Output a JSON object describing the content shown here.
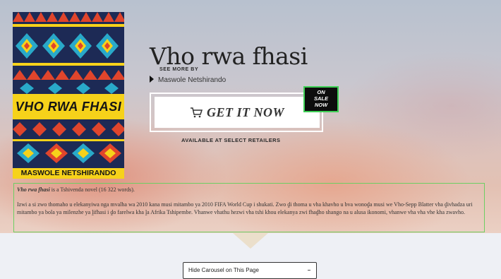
{
  "book": {
    "title": "Vho rwa fhasi",
    "see_more_label": "SEE MORE BY",
    "author": "Maswole Netshirando",
    "cover_title": "VHO RWA FHASI",
    "cover_author": "MASWOLE NETSHIRANDO"
  },
  "actions": {
    "get_it_label": "GET IT NOW",
    "sale_lines": [
      "ON",
      "SALE",
      "NOW"
    ],
    "available_text": "AVAILABLE AT SELECT RETAILERS"
  },
  "description": {
    "title": "Vho rwa fhasi",
    "summary": " is a Tshivenda novel (16 322 words).",
    "body": "Izwi a si zwo thomaho u elekanyiwa nga mvalha wa 2010 kana musi mitambo ya 2010 FIFA World Cup i shukati. Zwo ḓi thoma u vha khavho u bva wonoḓa musi we Vho-Sepp Blatter vha ḓivhadza uri mitambo ya bola ya milenzhe ya ḽifhasi i ḓo farelwa kha ḽa Afrika Tshipembe. Vhanwe vhathu hezwi vha tshi khou elekanya zwi fhaḓho shango na u alusa ikonomi, vhanwe vha vha vhe kha zwavho."
  },
  "footer": {
    "carousel_select": "Hide Carousel on This Page"
  },
  "colors": {
    "sale_border": "#3ecf55",
    "description_border": "#6ccf62",
    "cover_yellow": "#f6d21a",
    "cover_navy": "#1d2a55"
  },
  "icons": {
    "cart": "cart-icon",
    "arrow": "play-triangle-icon",
    "dropdown": "chevron-down-icon"
  }
}
